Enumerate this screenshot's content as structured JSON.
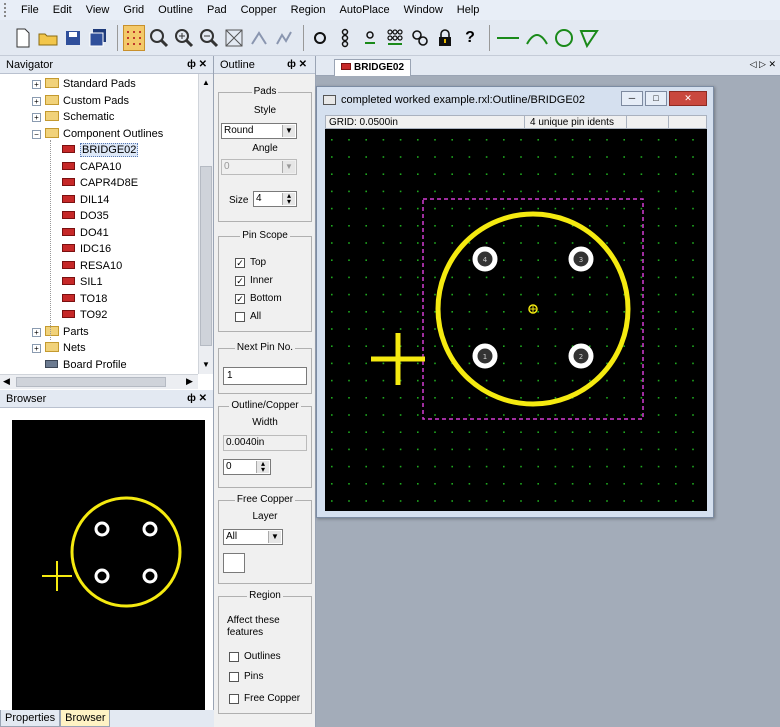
{
  "menu": [
    "File",
    "Edit",
    "View",
    "Grid",
    "Outline",
    "Pad",
    "Copper",
    "Region",
    "AutoPlace",
    "Window",
    "Help"
  ],
  "toolbar": {
    "icons": [
      "new-file-icon",
      "open-folder-icon",
      "save-icon",
      "save-all-icon",
      "grid-toggle-icon",
      "select-mode-icon",
      "zoom-in-icon",
      "zoom-out-icon",
      "zoom-fit-icon",
      "undo-icon",
      "redo-icon",
      "pad-icon",
      "pad-column-icon",
      "pad-row-icon",
      "pad-array-icon",
      "net-icon",
      "lock-icon",
      "help-icon",
      "line-icon",
      "arc-icon",
      "circle-icon",
      "polygon-icon"
    ],
    "help_label": "?"
  },
  "navigator": {
    "title": "Navigator",
    "controls": "ф ✕",
    "items": [
      {
        "label": "Standard Pads",
        "kind": "folder",
        "level": 1,
        "expander": "⊞"
      },
      {
        "label": "Custom Pads",
        "kind": "folder",
        "level": 1,
        "expander": "⊞"
      },
      {
        "label": "Schematic",
        "kind": "folder",
        "level": 1,
        "expander": "⊞"
      },
      {
        "label": "Component Outlines",
        "kind": "folder",
        "level": 1,
        "expander": "⊟"
      },
      {
        "label": "BRIDGE02",
        "kind": "component",
        "level": 2,
        "selected": true
      },
      {
        "label": "CAPA10",
        "kind": "component",
        "level": 2
      },
      {
        "label": "CAPR4D8E",
        "kind": "component",
        "level": 2
      },
      {
        "label": "DIL14",
        "kind": "component",
        "level": 2
      },
      {
        "label": "DO35",
        "kind": "component",
        "level": 2
      },
      {
        "label": "DO41",
        "kind": "component",
        "level": 2
      },
      {
        "label": "IDC16",
        "kind": "component",
        "level": 2
      },
      {
        "label": "RESA10",
        "kind": "component",
        "level": 2
      },
      {
        "label": "SIL1",
        "kind": "component",
        "level": 2
      },
      {
        "label": "TO18",
        "kind": "component",
        "level": 2
      },
      {
        "label": "TO92",
        "kind": "component",
        "level": 2
      },
      {
        "label": "Parts",
        "kind": "folder",
        "level": 1,
        "expander": "⊞"
      },
      {
        "label": "Nets",
        "kind": "folder",
        "level": 1,
        "expander": "⊞"
      },
      {
        "label": "Board Profile",
        "kind": "board",
        "level": 1
      }
    ]
  },
  "browser": {
    "title": "Browser",
    "controls": "ф ✕"
  },
  "bottom_tabs": [
    "Properties",
    "Browser"
  ],
  "outline_panel": {
    "title": "Outline",
    "controls": "ф ✕",
    "pads": {
      "group": "Pads",
      "style_label": "Style",
      "style_value": "Round",
      "angle_label": "Angle",
      "angle_value": "0",
      "size_label": "Size",
      "size_value": "4"
    },
    "pin_scope": {
      "group": "Pin Scope",
      "top": "Top",
      "inner": "Inner",
      "bottom": "Bottom",
      "all": "All",
      "checks": {
        "top": true,
        "inner": true,
        "bottom": true,
        "all": false
      }
    },
    "next_pin": {
      "group": "Next Pin No.",
      "value": "1"
    },
    "outline_copper": {
      "group": "Outline/Copper",
      "width_label": "Width",
      "width_value": "0.0040in",
      "spin_value": "0"
    },
    "free_copper": {
      "group": "Free Copper",
      "layer_label": "Layer",
      "layer_value": "All"
    },
    "region": {
      "group": "Region",
      "desc": "Affect these features",
      "outlines": "Outlines",
      "pins": "Pins",
      "free_copper": "Free Copper"
    }
  },
  "document": {
    "tab_label": "BRIDGE02",
    "tab_nav": "◁ ▷ ✕",
    "window_title": "completed worked example.rxl:Outline/BRIDGE02",
    "grid_text": "GRID:  0.0500in",
    "pin_idents": "4 unique pin idents",
    "pins": [
      "1",
      "2",
      "3",
      "4"
    ]
  },
  "colors": {
    "outline": "#f5ea10",
    "grid_dot": "#1fa81f",
    "bbox": "#d23cd2",
    "pad": "#ffffff",
    "canvas": "#000000",
    "selection": "#2f6fc9"
  }
}
